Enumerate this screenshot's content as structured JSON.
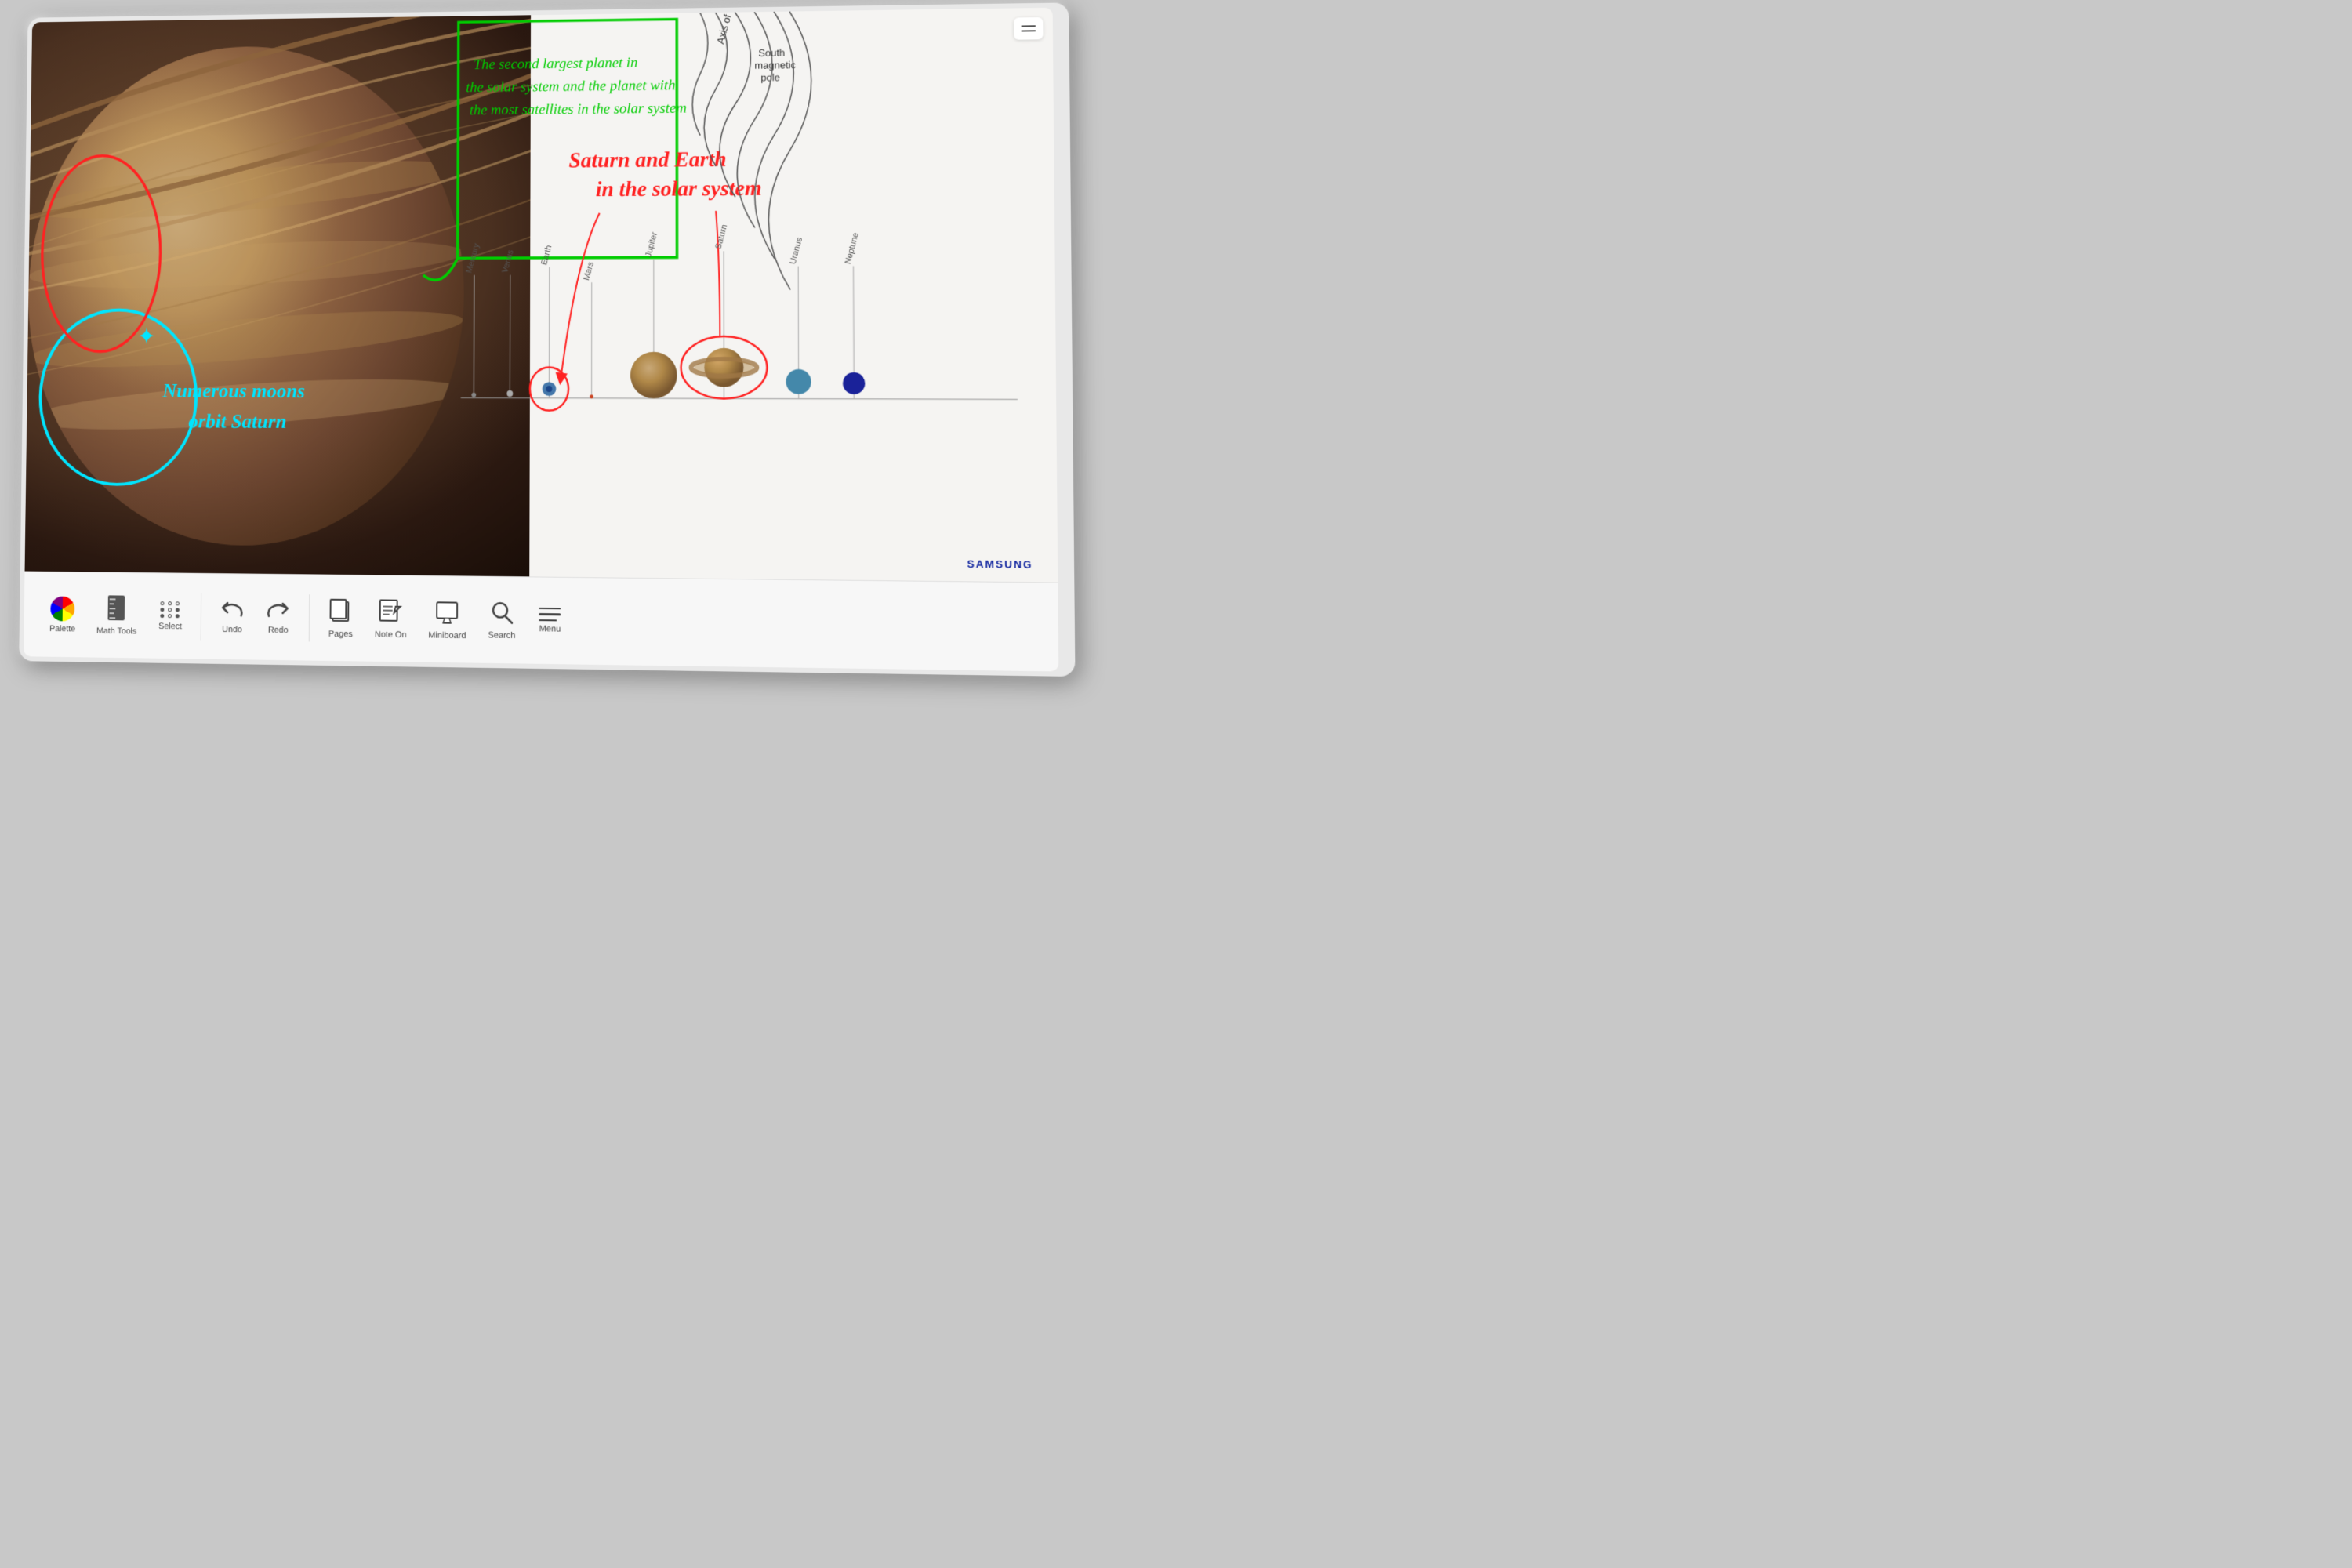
{
  "device": {
    "brand": "SAMSUNG",
    "type": "interactive_display"
  },
  "annotations": {
    "green_text": "The second largest planet in\nthe solar system and the planet with\nthe most satellites in the solar system",
    "red_text": "Saturn and Earth\nin the solar system",
    "cyan_text": "Numerous moons\norbit Saturn",
    "south_pole_label": "South\nmagnetic\npole",
    "axis_label": "Axis of rotation"
  },
  "solar_system": {
    "planets": [
      "Mercury",
      "Venus",
      "Earth",
      "Mars",
      "Jupiter",
      "Saturn",
      "Uranus",
      "Neptune"
    ]
  },
  "toolbar": {
    "palette_label": "Palette",
    "math_tools_label": "Math Tools",
    "select_label": "Select",
    "undo_label": "Undo",
    "redo_label": "Redo",
    "pages_label": "Pages",
    "note_on_label": "Note On",
    "miniboard_label": "Miniboard",
    "search_label": "Search",
    "menu_label": "Menu"
  },
  "colors": {
    "cyan": "#00e5ff",
    "red": "#ff2020",
    "green": "#00cc00",
    "toolbar_bg": "#f7f7f7",
    "screen_bg": "#f5f4f2",
    "samsung_blue": "#1428A0"
  }
}
